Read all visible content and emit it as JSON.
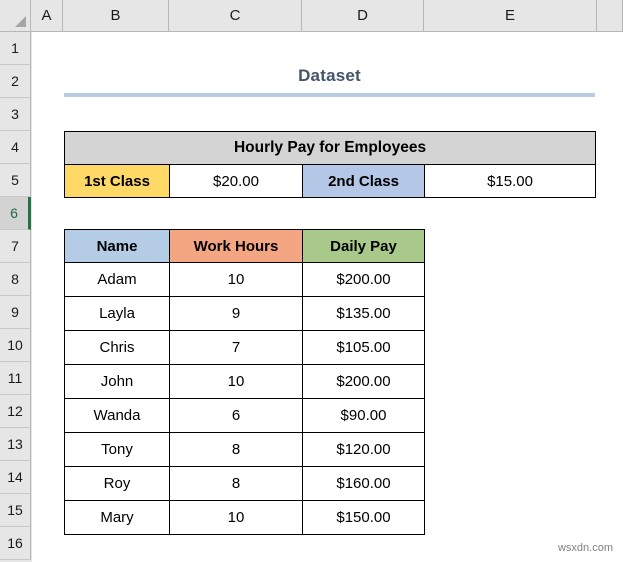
{
  "spreadsheet": {
    "column_headers": [
      "A",
      "B",
      "C",
      "D",
      "E"
    ],
    "row_headers": [
      "1",
      "2",
      "3",
      "4",
      "5",
      "6",
      "7",
      "8",
      "9",
      "10",
      "11",
      "12",
      "13",
      "14",
      "15",
      "16"
    ],
    "active_row": "6",
    "corner_icon": "select-all-triangle-icon"
  },
  "title": {
    "text": "Dataset",
    "color": "#44546a",
    "underline_color": "#b8cce4"
  },
  "hourly_pay_table": {
    "banner": "Hourly Pay for Employees",
    "banner_color": "#d4d4d4",
    "rows": [
      {
        "class1_label": "1st Class",
        "class1_value": "$20.00",
        "class1_color": "#ffd966",
        "class2_label": "2nd Class",
        "class2_value": "$15.00",
        "class2_color": "#b4c7e7"
      }
    ]
  },
  "employee_table": {
    "headers": [
      "Name",
      "Work Hours",
      "Daily Pay"
    ],
    "header_colors": [
      "#b4cce4",
      "#f4a582",
      "#a9c98a"
    ],
    "rows": [
      {
        "name": "Adam",
        "hours": "10",
        "pay": "$200.00"
      },
      {
        "name": "Layla",
        "hours": "9",
        "pay": "$135.00"
      },
      {
        "name": "Chris",
        "hours": "7",
        "pay": "$105.00"
      },
      {
        "name": "John",
        "hours": "10",
        "pay": "$200.00"
      },
      {
        "name": "Wanda",
        "hours": "6",
        "pay": "$90.00"
      },
      {
        "name": "Tony",
        "hours": "8",
        "pay": "$120.00"
      },
      {
        "name": "Roy",
        "hours": "8",
        "pay": "$160.00"
      },
      {
        "name": "Mary",
        "hours": "10",
        "pay": "$150.00"
      }
    ]
  },
  "watermark": {
    "text": "wsxdn.com"
  }
}
